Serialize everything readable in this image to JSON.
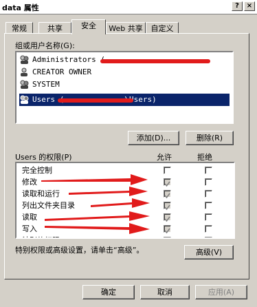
{
  "window": {
    "title": "data 属性",
    "help_label": "?",
    "close_label": "×"
  },
  "tabs": [
    {
      "label": "常规"
    },
    {
      "label": "共享"
    },
    {
      "label": "安全"
    },
    {
      "label": "Web 共享"
    },
    {
      "label": "自定义"
    }
  ],
  "security": {
    "groups_label": "组或用户名称(G):",
    "users": [
      {
        "name": "Administrators (",
        "icon": "group-icon"
      },
      {
        "name": "CREATOR OWNER",
        "icon": "user-icon"
      },
      {
        "name": "SYSTEM",
        "icon": "group-icon"
      },
      {
        "name": "Users (",
        "suffix": "\\Users)",
        "icon": "group-icon",
        "selected": true
      }
    ],
    "add_button": "添加(D)...",
    "remove_button": "删除(R)",
    "perm_label": "Users 的权限(P)",
    "allow_header": "允许",
    "deny_header": "拒绝",
    "permissions": [
      {
        "label": "完全控制",
        "allow": false,
        "deny": false,
        "allow_disabled": false
      },
      {
        "label": "修改",
        "allow": true,
        "deny": false,
        "allow_disabled": true
      },
      {
        "label": "读取和运行",
        "allow": true,
        "deny": false,
        "allow_disabled": true
      },
      {
        "label": "列出文件夹目录",
        "allow": true,
        "deny": false,
        "allow_disabled": true
      },
      {
        "label": "读取",
        "allow": true,
        "deny": false,
        "allow_disabled": true
      },
      {
        "label": "写入",
        "allow": true,
        "deny": false,
        "allow_disabled": true
      },
      {
        "label": "特别的权限",
        "allow": false,
        "deny": false,
        "allow_disabled": false
      }
    ],
    "advanced_hint": "特别权限或高级设置，请单击“高级”。",
    "advanced_button": "高级(V)"
  },
  "footer": {
    "ok_button": "确定",
    "cancel_button": "取消",
    "apply_button": "应用(A)"
  },
  "colors": {
    "dialog_bg": "#d4d0c8",
    "selection": "#0a246a",
    "annotation_red": "#e11b1b"
  }
}
